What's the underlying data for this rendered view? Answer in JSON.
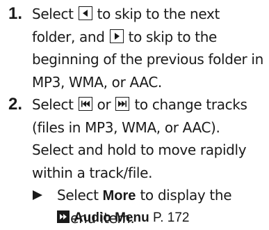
{
  "step1": {
    "number": "1.",
    "line1_a": "Select",
    "line1_b": "to skip to the next",
    "line2_a": "folder, and",
    "line2_b": "to skip to the",
    "line3": "beginning of the previous folder in",
    "line4": "MP3, WMA, or AAC.",
    "icon_left": "folder-down-icon",
    "icon_right": "folder-up-icon"
  },
  "step2": {
    "number": "2.",
    "line1_a": "Select",
    "line1_b": "or",
    "line1_c": "to change tracks",
    "line2": "(files in MP3, WMA, or AAC).",
    "line3": "Select and hold to move rapidly",
    "line4": "within a track/file.",
    "icon_prev": "skip-back-icon",
    "icon_next": "skip-forward-icon"
  },
  "note": {
    "line1_a": "Select",
    "line1_bold": "More",
    "line1_b": "to display the",
    "line2": "menu item."
  },
  "reference": {
    "title": "Audio Menu",
    "page": "P. 172"
  }
}
